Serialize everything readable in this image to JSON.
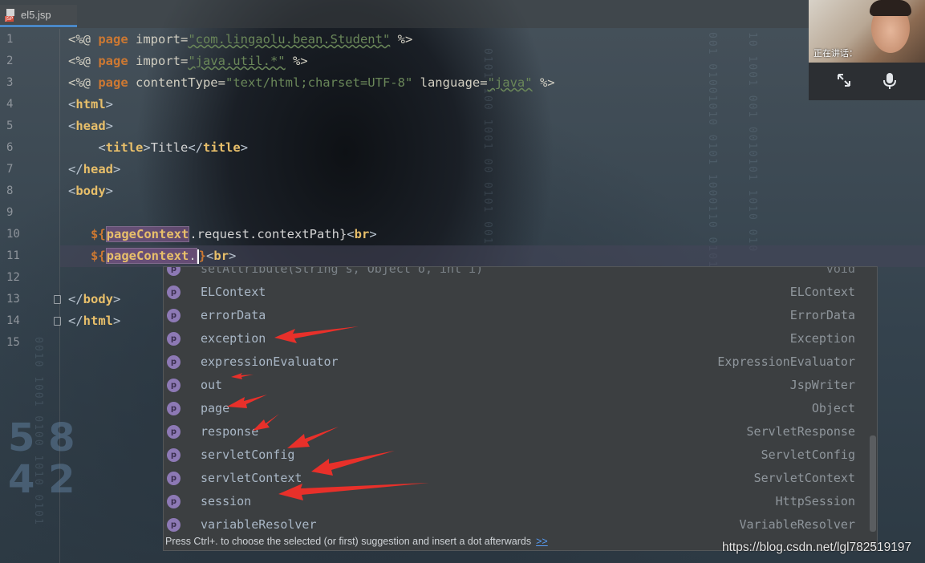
{
  "editor": {
    "tab": {
      "filename": "el5.jsp",
      "icon": "jsp-file-icon",
      "icon_badge": "JSP"
    },
    "line_numbers": [
      "1",
      "2",
      "3",
      "4",
      "5",
      "6",
      "7",
      "8",
      "9",
      "10",
      "11",
      "12",
      "13",
      "14",
      "15"
    ],
    "code": {
      "l1": {
        "open": "<%@ ",
        "kw": "page",
        "attr": " import=",
        "val": "\"com.lingaolu.bean.Student\"",
        "close": " %>"
      },
      "l2": {
        "open": "<%@ ",
        "kw": "page",
        "attr": " import=",
        "val": "\"java.util.*\"",
        "close": " %>"
      },
      "l3": {
        "open": "<%@ ",
        "kw": "page",
        "attr1": " contentType=",
        "val1": "\"text/html;charset=UTF-8\"",
        "attr2": " language=",
        "val2": "\"java\"",
        "close": " %>"
      },
      "l4": {
        "lt": "<",
        "tag": "html",
        "gt": ">"
      },
      "l5": {
        "lt": "<",
        "tag": "head",
        "gt": ">"
      },
      "l6": {
        "indent": "    ",
        "lt": "<",
        "tag": "title",
        "gt": ">",
        "text": "Title",
        "lt2": "</",
        "tag2": "title",
        "gt2": ">"
      },
      "l7": {
        "lt": "</",
        "tag": "head",
        "gt": ">"
      },
      "l8": {
        "lt": "<",
        "tag": "body",
        "gt": ">"
      },
      "l10": {
        "indent": "   ",
        "open": "${",
        "ctx": "pageContext",
        "rest": ".request.contextPath}",
        "lt": "<",
        "tag": "br",
        "gt": ">"
      },
      "l11": {
        "indent": "   ",
        "open": "${",
        "ctx": "pageContext",
        "dot": ".",
        "close": "}",
        "lt": "<",
        "tag": "br",
        "gt": ">"
      },
      "l13": {
        "lt": "</",
        "tag": "body",
        "gt": ">"
      },
      "l14": {
        "lt": "</",
        "tag": "html",
        "gt": ">"
      }
    }
  },
  "completion": {
    "items": [
      {
        "name": "setAttribute(String s, Object o, int i)",
        "type": "void"
      },
      {
        "name": "ELContext",
        "type": "ELContext"
      },
      {
        "name": "errorData",
        "type": "ErrorData"
      },
      {
        "name": "exception",
        "type": "Exception"
      },
      {
        "name": "expressionEvaluator",
        "type": "ExpressionEvaluator"
      },
      {
        "name": "out",
        "type": "JspWriter"
      },
      {
        "name": "page",
        "type": "Object"
      },
      {
        "name": "response",
        "type": "ServletResponse"
      },
      {
        "name": "servletConfig",
        "type": "ServletConfig"
      },
      {
        "name": "servletContext",
        "type": "ServletContext"
      },
      {
        "name": "session",
        "type": "HttpSession"
      },
      {
        "name": "variableResolver",
        "type": "VariableResolver"
      }
    ],
    "item_icon": "property-icon",
    "item_icon_letter": "p",
    "hint": "Press Ctrl+. to choose the selected (or first) suggestion and insert a dot afterwards",
    "hint_link": ">>"
  },
  "video_call": {
    "speaker_label": "正在讲话：",
    "controls": [
      "fullscreen-icon",
      "microphone-icon"
    ]
  },
  "watermark": "https://blog.csdn.net/lgl782519197",
  "colors": {
    "keyword": "#cc7832",
    "string": "#6a8759",
    "tag": "#e8bf6a",
    "badge": "#8d79b5",
    "annotation_arrow": "#e8302a"
  }
}
